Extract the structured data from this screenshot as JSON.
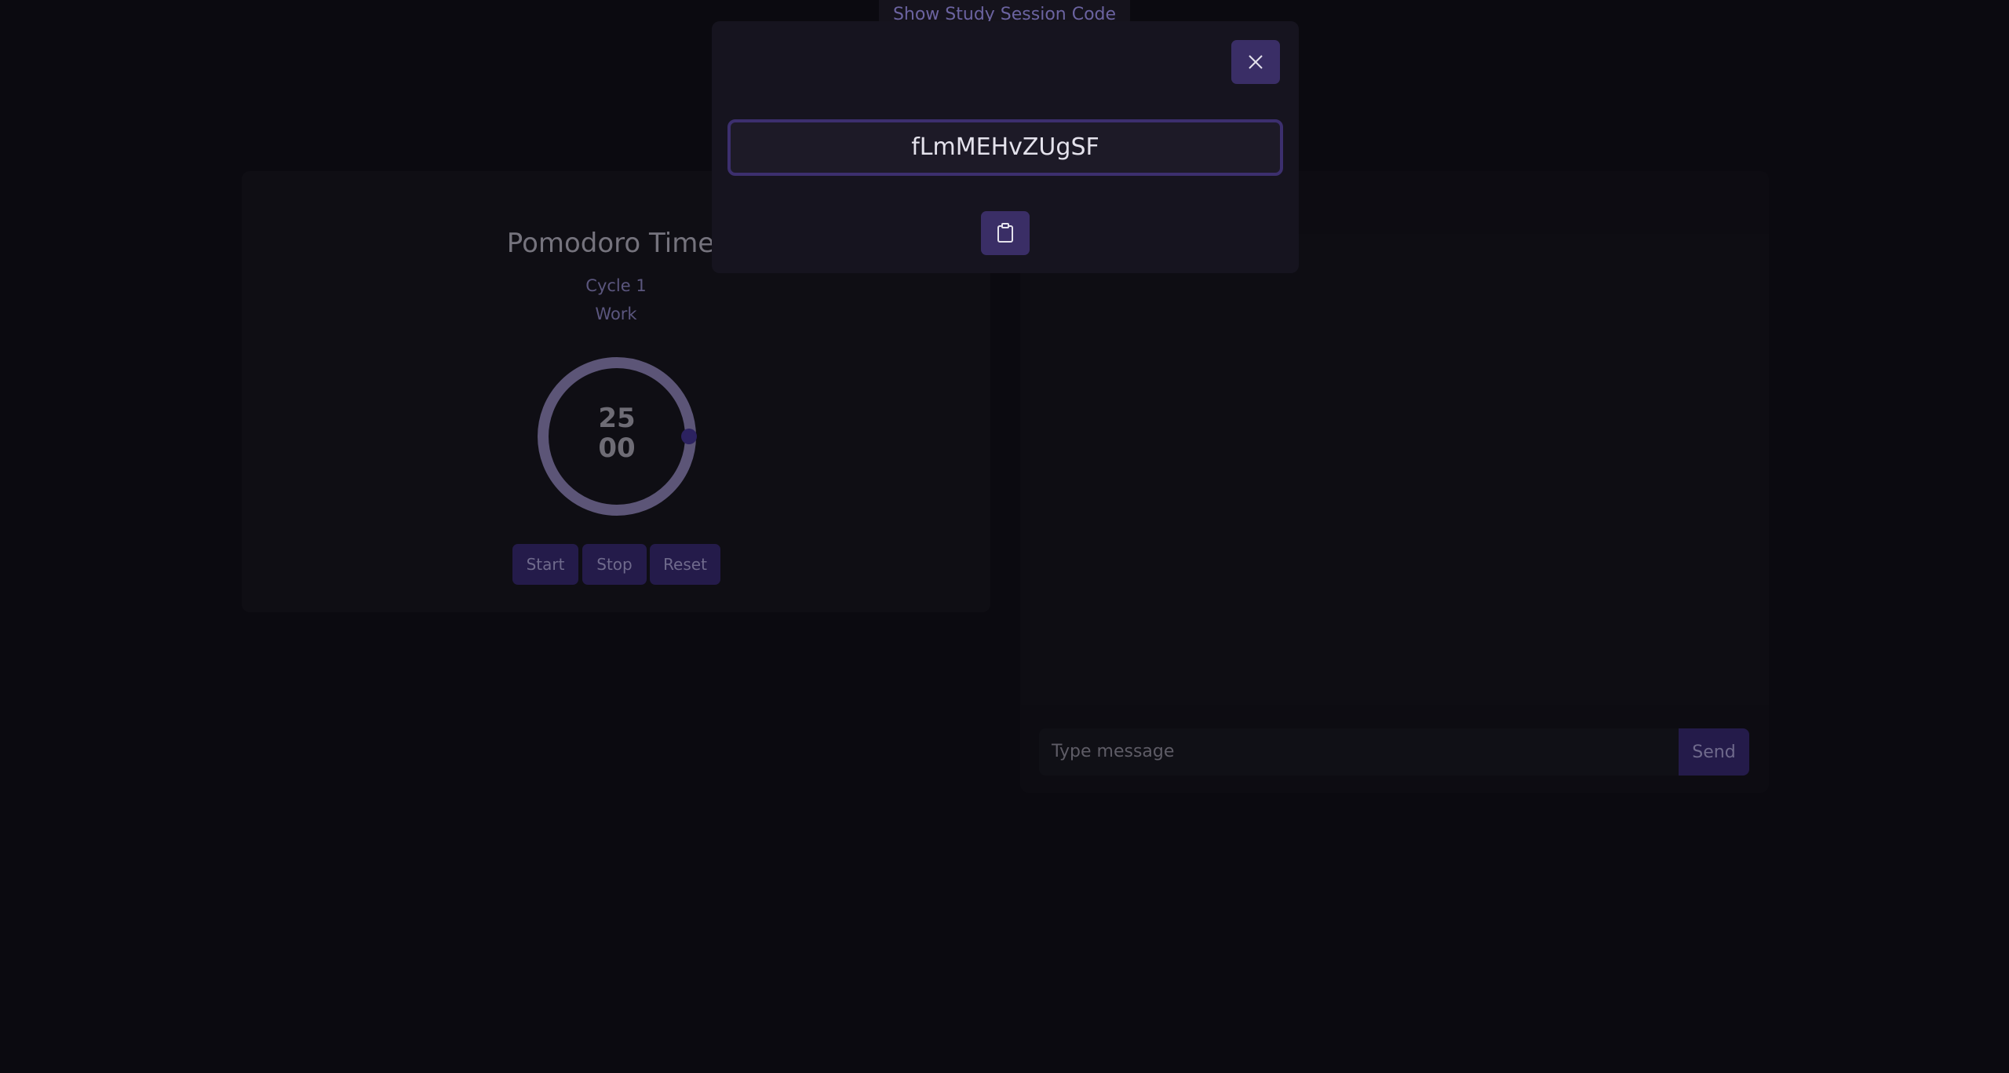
{
  "header": {
    "show_code_label": "Show Study Session Code"
  },
  "timer": {
    "title": "Pomodoro Timer",
    "cycle": "Cycle 1",
    "phase": "Work",
    "minutes": "25",
    "seconds": "00",
    "buttons": {
      "start": "Start",
      "stop": "Stop",
      "reset": "Reset"
    }
  },
  "chat": {
    "input_placeholder": "Type message",
    "send_label": "Send"
  },
  "modal": {
    "session_code": "fLmMEHvZUgSF",
    "close_icon": "close-icon",
    "copy_icon": "clipboard-icon"
  },
  "colors": {
    "background": "#0b0a10",
    "accent": "#3a2e66",
    "button": "#241b4a",
    "ring": "#5c5577"
  }
}
